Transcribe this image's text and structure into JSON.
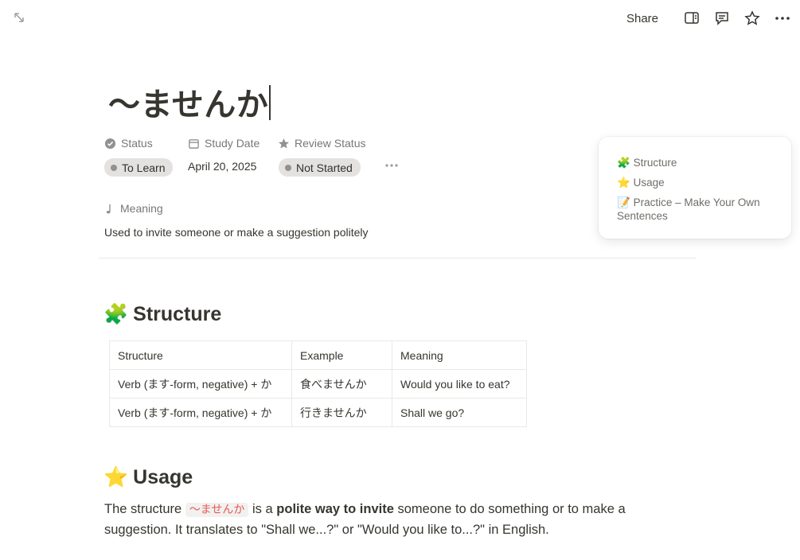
{
  "topbar": {
    "share_label": "Share",
    "icons": [
      "sidebar-panel-icon",
      "comment-icon",
      "star-icon",
      "more-icon"
    ]
  },
  "page": {
    "title": "〜ませんか"
  },
  "properties": {
    "status": {
      "label": "Status",
      "value": "To Learn"
    },
    "study_date": {
      "label": "Study Date",
      "value": "April 20, 2025"
    },
    "review_status": {
      "label": "Review Status",
      "value": "Not Started"
    },
    "meaning": {
      "label": "Meaning",
      "value": "Used to invite someone or make a suggestion politely"
    }
  },
  "toc": {
    "items": [
      {
        "emoji": "🧩",
        "label": "Structure"
      },
      {
        "emoji": "⭐",
        "label": "Usage"
      },
      {
        "emoji": "📝",
        "label": "Practice – Make Your Own Sentences"
      }
    ]
  },
  "structure": {
    "heading": "Structure",
    "table": {
      "rows": [
        [
          "Structure",
          "Example",
          "Meaning"
        ],
        [
          "Verb (ます-form, negative) + か",
          "食べませんか",
          "Would you like to eat?"
        ],
        [
          "Verb (ます-form, negative) + か",
          "行きませんか",
          "Shall we go?"
        ]
      ]
    }
  },
  "usage": {
    "heading": "Usage",
    "p_before": "The structure",
    "code": "〜ませんか",
    "p_mid": "is a",
    "p_bold": "polite way to invite",
    "p_after": "someone to do something or to make a suggestion. It translates to \"Shall we...?\" or \"Would you like to...?\" in English."
  },
  "colors": {
    "text": "#37352f",
    "muted": "#787774",
    "pill_bg": "#e3e2e0",
    "code_red": "#eb5757"
  }
}
